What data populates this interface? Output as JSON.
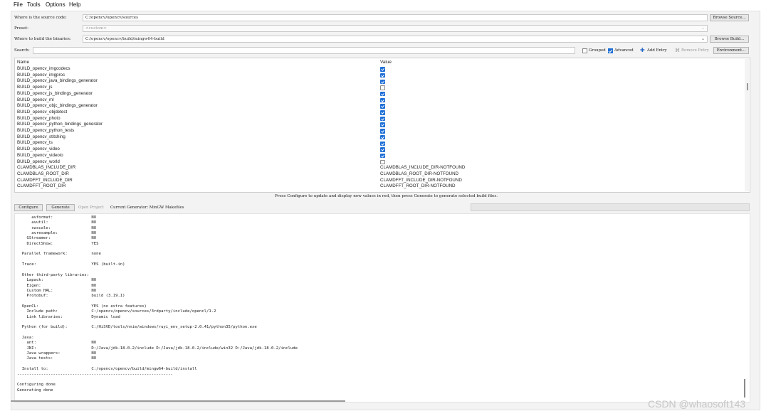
{
  "menu": [
    "File",
    "Tools",
    "Options",
    "Help"
  ],
  "source": {
    "label": "Where is the source code:",
    "value": "C:/opencv/opencv/sources",
    "button": "Browse Source..."
  },
  "preset": {
    "label": "Preset:",
    "value": "<custom>"
  },
  "build": {
    "label": "Where to build the binaries:",
    "value": "C:/opencv/opencv/build/mingw64-build",
    "button": "Browse Build..."
  },
  "search": {
    "label": "Search:",
    "value": ""
  },
  "options": {
    "grouped": "Grouped",
    "advanced": "Advanced",
    "add_entry": "Add Entry",
    "remove_entry": "Remove Entry",
    "environment": "Environment..."
  },
  "cache": {
    "headers": {
      "name": "Name",
      "value": "Value"
    },
    "rows": [
      {
        "name": "BUILD_opencv_imgcodecs",
        "checked": true
      },
      {
        "name": "BUILD_opencv_imgproc",
        "checked": true
      },
      {
        "name": "BUILD_opencv_java_bindings_generator",
        "checked": true
      },
      {
        "name": "BUILD_opencv_js",
        "checked": false
      },
      {
        "name": "BUILD_opencv_js_bindings_generator",
        "checked": true
      },
      {
        "name": "BUILD_opencv_ml",
        "checked": true
      },
      {
        "name": "BUILD_opencv_objc_bindings_generator",
        "checked": true
      },
      {
        "name": "BUILD_opencv_objdetect",
        "checked": true
      },
      {
        "name": "BUILD_opencv_photo",
        "checked": true
      },
      {
        "name": "BUILD_opencv_python_bindings_generator",
        "checked": true
      },
      {
        "name": "BUILD_opencv_python_tests",
        "checked": true
      },
      {
        "name": "BUILD_opencv_stitching",
        "checked": true
      },
      {
        "name": "BUILD_opencv_ts",
        "checked": true
      },
      {
        "name": "BUILD_opencv_video",
        "checked": true
      },
      {
        "name": "BUILD_opencv_videoio",
        "checked": true
      },
      {
        "name": "BUILD_opencv_world",
        "checked": false
      },
      {
        "name": "CLAMDBLAS_INCLUDE_DIR",
        "value": "CLAMDBLAS_INCLUDE_DIR-NOTFOUND"
      },
      {
        "name": "CLAMDBLAS_ROOT_DIR",
        "value": "CLAMDBLAS_ROOT_DIR-NOTFOUND"
      },
      {
        "name": "CLAMDFFT_INCLUDE_DIR",
        "value": "CLAMDFFT_INCLUDE_DIR-NOTFOUND"
      },
      {
        "name": "CLAMDFFT_ROOT_DIR",
        "value": "CLAMDFFT_ROOT_DIR-NOTFOUND"
      }
    ]
  },
  "status_line": "Press Configure to update and display new values in red, then press Generate to generate selected build files.",
  "actions": {
    "configure": "Configure",
    "generate": "Generate",
    "open_project": "Open Project",
    "current_generator": "Current Generator: MinGW Makefiles"
  },
  "output_lines": [
    "      avformat:                NO",
    "      avutil:                  NO",
    "      swscale:                 NO",
    "      avresample:              NO",
    "    GStreamer:                 NO",
    "    DirectShow:                YES",
    "",
    "  Parallel framework:          none",
    "",
    "  Trace:                       YES (built-in)",
    "",
    "  Other third-party libraries:",
    "    Lapack:                    NO",
    "    Eigen:                     NO",
    "    Custom HAL:                NO",
    "    Protobuf:                  build (3.19.1)",
    "",
    "  OpenCL:                      YES (no extra features)",
    "    Include path:              C:/opencv/opencv/sources/3rdparty/include/opencl/1.2",
    "    Link libraries:            Dynamic load",
    "",
    "  Python (for build):          C:/HiSVD/tools/nnie/windows/ruyi_env_setup-2.0.41/python35/python.exe",
    "",
    "  Java:",
    "    ant:                       NO",
    "    JNI:                       D:/Java/jdk-18.0.2/include D:/Java/jdk-18.0.2/include/win32 D:/Java/jdk-18.0.2/include",
    "    Java wrappers:             NO",
    "    Java tests:                NO",
    "",
    "  Install to:                  C:/opencv/opencv/build/mingw64-build/install",
    "-----------------------------------------------------------------",
    "",
    "Configuring done",
    "Generating done"
  ],
  "watermark": "CSDN @whaosoft143"
}
